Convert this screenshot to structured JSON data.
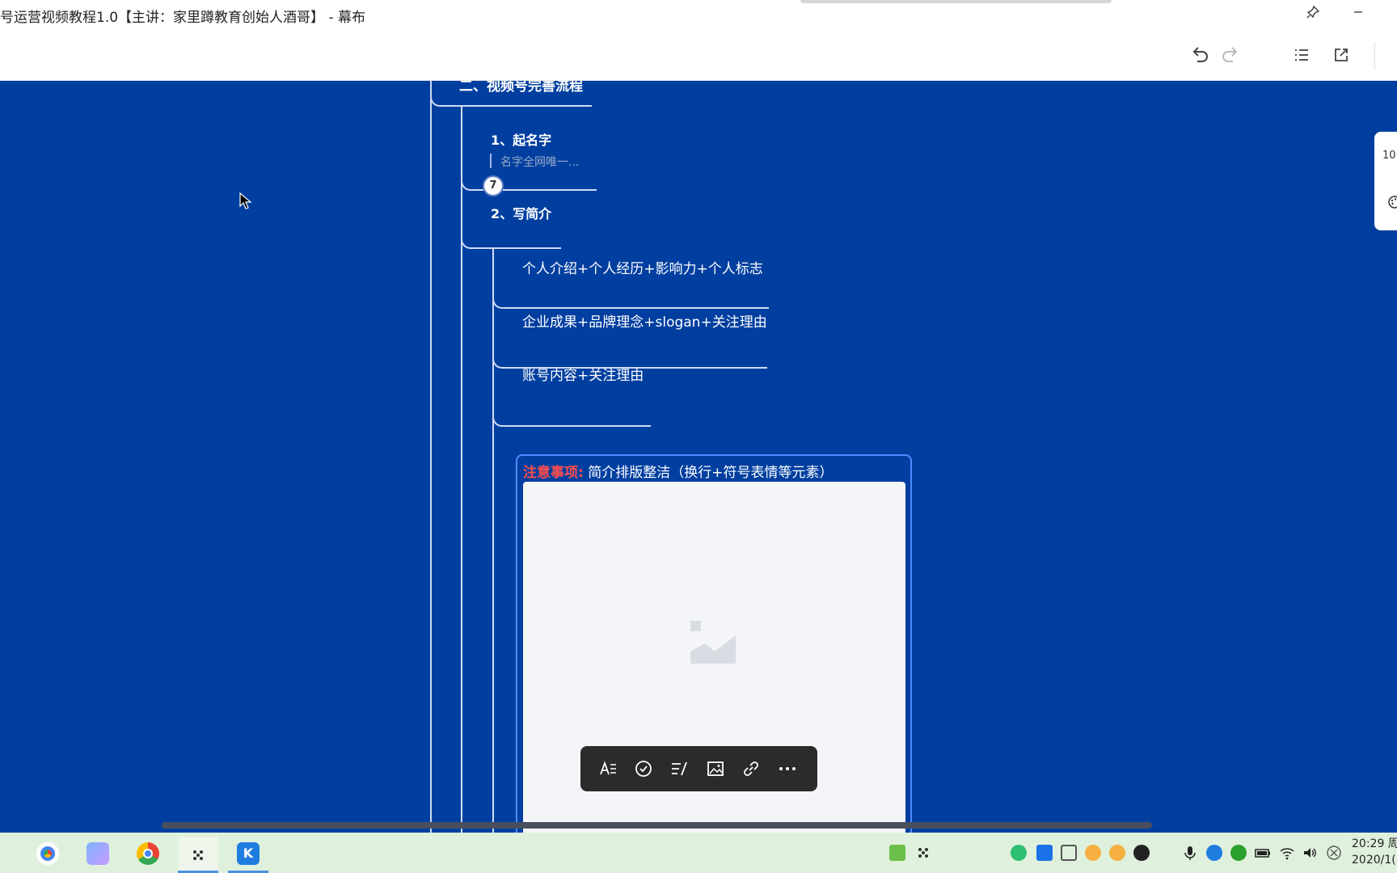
{
  "window": {
    "title": "号运营视频教程1.0【主讲：家里蹲教育创始人酒哥】 - 幕布"
  },
  "toolbar": {
    "icons": [
      "undo-icon",
      "redo-icon",
      "outline-list-icon",
      "open-external-icon"
    ]
  },
  "mindmap": {
    "section_title": "二、视频号完善流程",
    "step1": {
      "title": "1、起名字",
      "note": "名字全网唯一...",
      "badge": "7"
    },
    "step2": {
      "title": "2、写简介",
      "items": [
        "个人介绍+个人经历+影响力+个人标志",
        "企业成果+品牌理念+slogan+关注理由",
        "账号内容+关注理由"
      ],
      "selected_node": {
        "warn_label": "注意事项:",
        "text": "简介排版整洁（换行+符号表情等元素）"
      }
    }
  },
  "format_toolbar": {
    "icons": [
      "text-style-icon",
      "checkbox-icon",
      "note-icon",
      "image-icon",
      "link-icon",
      "more-icon"
    ]
  },
  "side_panel": {
    "zoom": "10"
  },
  "taskbar": {
    "time": "20:29 周",
    "date": "2020/1(",
    "apps": [
      "chrome-like-app-icon",
      "photos-app-icon",
      "chrome-icon",
      "mubu-icon",
      "kugou-icon"
    ]
  },
  "colors": {
    "canvas_bg": "#003fa0",
    "line": "#cfdcf3",
    "selection": "#4f8cff",
    "warn": "#ff4d4d",
    "taskbar_bg": "#dff1dc"
  }
}
